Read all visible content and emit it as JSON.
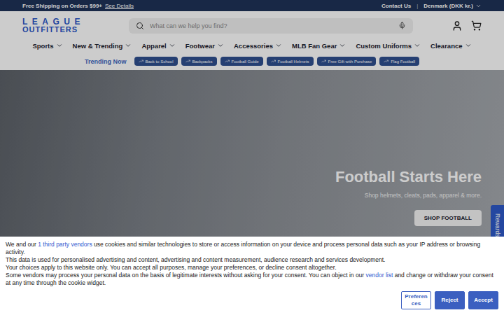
{
  "announcement": {
    "text": "Free Shipping on Orders $99+",
    "link": "See Details"
  },
  "utility": {
    "contact": "Contact Us",
    "separator": "|",
    "region": "Denmark (DKK kr.)"
  },
  "logo": {
    "line1": "LEAGUE",
    "line2": "OUTFITTERS"
  },
  "search": {
    "placeholder": "What can we help you find?"
  },
  "nav": [
    {
      "label": "Sports"
    },
    {
      "label": "New & Trending"
    },
    {
      "label": "Apparel"
    },
    {
      "label": "Footwear"
    },
    {
      "label": "Accessories"
    },
    {
      "label": "MLB Fan Gear"
    },
    {
      "label": "Custom Uniforms"
    },
    {
      "label": "Clearance"
    }
  ],
  "trending": {
    "title": "Trending Now",
    "tags": [
      {
        "label": "Back to School"
      },
      {
        "label": "Backpacks"
      },
      {
        "label": "Football Guide"
      },
      {
        "label": "Football Helmets"
      },
      {
        "label": "Free Gift with Purchase"
      },
      {
        "label": "Flag Football"
      }
    ]
  },
  "hero": {
    "title": "Football Starts Here",
    "subtitle": "Shop helmets, cleats, pads, apparel & more.",
    "button": "SHOP FOOTBALL"
  },
  "rewards": {
    "label": "Rewards"
  },
  "cookie": {
    "paragraphs": [
      [
        {
          "text": "We and our ",
          "link": false
        },
        {
          "text": "1 third party vendors",
          "link": true
        },
        {
          "text": " use cookies and similar technologies to store or access information on your device and process personal data such as your IP address or browsing activity.",
          "link": false
        }
      ],
      [
        {
          "text": "This data is used for personalised advertising and content, advertising and content measurement, audience research and services development.",
          "link": false
        }
      ],
      [
        {
          "text": "Your choices apply to this website only. You can accept all purposes, manage your preferences, or decline consent altogether.",
          "link": false
        }
      ],
      [
        {
          "text": "Some vendors may process your personal data on the basis of legitimate interests without asking for your consent. You can object in our ",
          "link": false
        },
        {
          "text": "vendor list",
          "link": true
        },
        {
          "text": " and change or withdraw your consent at any time through the cookie widget.",
          "link": false
        }
      ]
    ],
    "buttons": [
      {
        "label": "Preferences",
        "kind": "outline"
      },
      {
        "label": "Reject",
        "kind": "solid"
      },
      {
        "label": "Accept",
        "kind": "solid"
      }
    ]
  }
}
